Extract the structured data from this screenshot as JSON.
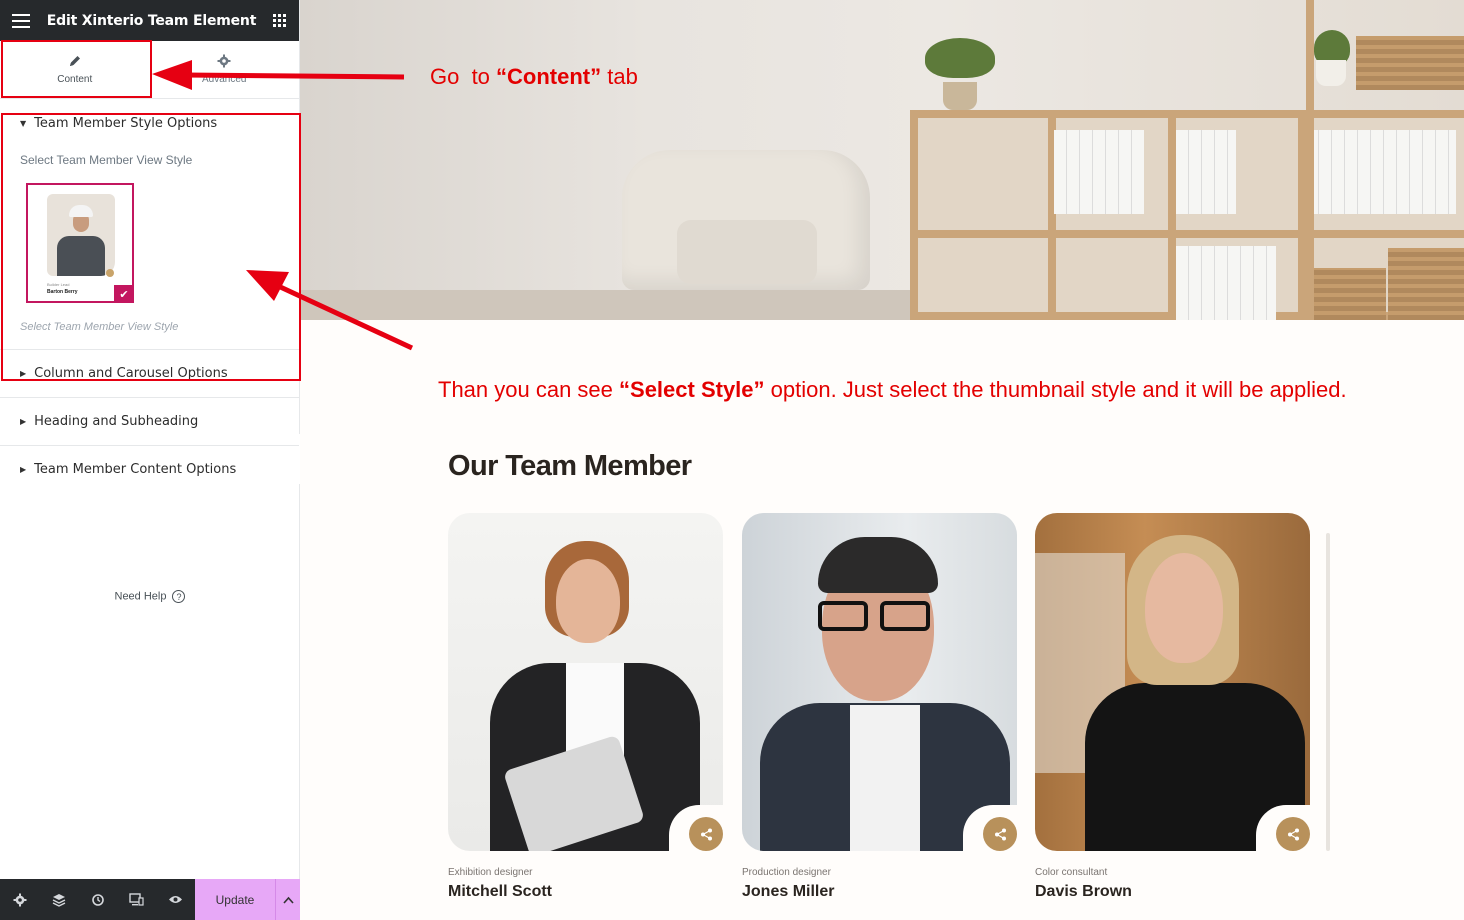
{
  "editor": {
    "title": "Edit Xinterio Team Element",
    "tabs": [
      {
        "label": "Content",
        "icon": "pencil-icon"
      },
      {
        "label": "Advanced",
        "icon": "gear-icon"
      }
    ],
    "open_section": {
      "title": "Team Member Style Options",
      "field_label": "Select Team Member View Style",
      "thumbnail": {
        "role": "Builder Lead",
        "name": "Barton Berry",
        "selected": true
      },
      "description": "Select Team Member View Style"
    },
    "collapsed_sections": [
      "Column and Carousel Options",
      "Heading and Subheading",
      "Team Member Content Options"
    ],
    "need_help": "Need Help",
    "footer": {
      "icons": [
        "settings-icon",
        "layers-icon",
        "history-icon",
        "responsive-icon",
        "preview-icon"
      ],
      "update_label": "Update"
    }
  },
  "annotations": {
    "tab_hint": {
      "prefix": "Go  to ",
      "emph": "“Content”",
      "suffix": " tab"
    },
    "style_hint": {
      "prefix": "Than you can see ",
      "emph": "“Select Style”",
      "suffix": " option. Just select the thumbnail style and it will be applied."
    },
    "color": "#e60012"
  },
  "preview": {
    "heading": "Our Team Member",
    "members": [
      {
        "role": "Exhibition designer",
        "name": "Mitchell Scott"
      },
      {
        "role": "Production designer",
        "name": "Jones Miller"
      },
      {
        "role": "Color consultant",
        "name": "Davis Brown"
      }
    ],
    "accent_color": "#b8915b"
  }
}
